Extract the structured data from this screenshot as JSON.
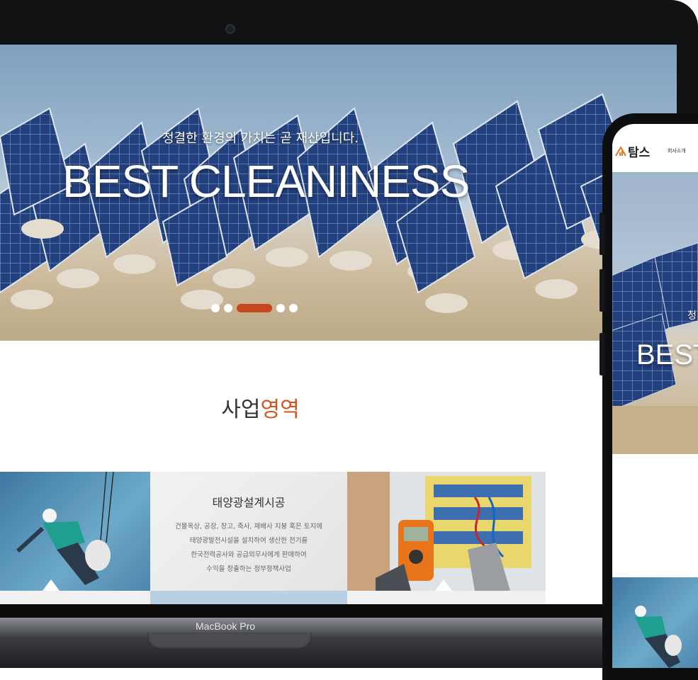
{
  "device_labels": {
    "laptop": "MacBook Pro"
  },
  "hero": {
    "subtitle": "청결한 환경의 가치는 곧 재산입니다.",
    "title": "BEST CLEANINESS",
    "slides": 5,
    "active_slide": 3
  },
  "section": {
    "title_plain": "사업",
    "title_accent": "영역"
  },
  "cards": [
    {
      "type": "image",
      "depicts": "window-cleaning-worker"
    },
    {
      "type": "text",
      "title": "태양광설계시공",
      "lines": [
        "건물옥상, 공장, 창고, 축사, 재배사 지붕 혹은 토지에",
        "태양광발전시설을 설치하여 생산한 전기를",
        "한국전력공사와 공급의무사에게 판매하여",
        "수익을 창출하는 정부정책사업"
      ]
    },
    {
      "type": "image",
      "depicts": "electrician-with-multimeter"
    }
  ],
  "mobile": {
    "logo": "탐스",
    "nav_item": "회사소개",
    "hero_sub": "청",
    "hero_title": "BEST"
  },
  "colors": {
    "accent": "#d9531e",
    "dot_active": "#c8461b"
  }
}
